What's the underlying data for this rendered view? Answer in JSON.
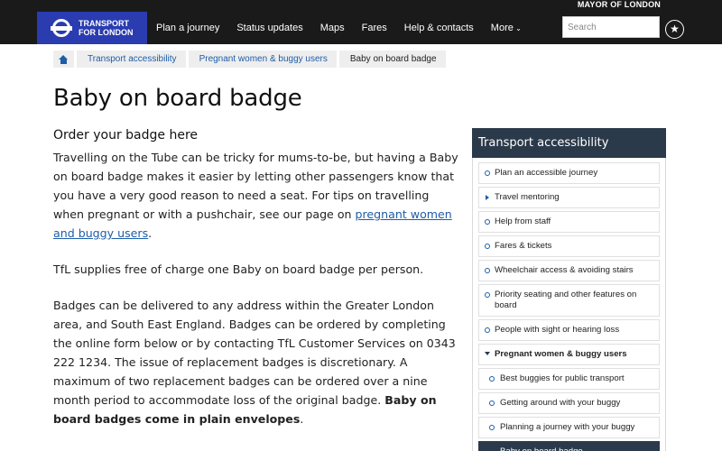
{
  "header": {
    "mayor": "MAYOR OF LONDON",
    "logo_line1": "TRANSPORT",
    "logo_line2": "FOR LONDON",
    "nav": [
      "Plan a journey",
      "Status updates",
      "Maps",
      "Fares",
      "Help & contacts",
      "More"
    ],
    "search_placeholder": "Search",
    "star_icon": "star-icon"
  },
  "breadcrumb": [
    "Transport accessibility",
    "Pregnant women & buggy users",
    "Baby on board badge"
  ],
  "main": {
    "title": "Baby on board badge",
    "subhead": "Order your badge here",
    "p1_before": "Travelling on the Tube can be tricky for mums-to-be, but having a Baby on board badge makes it easier by letting other passengers know that you have a very good reason to need a seat. For tips on travelling when pregnant or with a pushchair, see our page on ",
    "p1_link": "pregnant women and buggy users",
    "p1_after": ".",
    "p2": "TfL supplies free of charge one Baby on board badge per person.",
    "p3_text": "Badges can be delivered to any address within the Greater London area, and South East England. Badges can be ordered by completing the online form below or by contacting TfL Customer Services on 0343 222 1234. The issue of replacement badges is discretionary. A maximum of two replacement badges can be ordered over a nine month period to accommodate loss of the original badge. ",
    "p3_bold": "Baby on board badges come in plain envelopes",
    "p3_end": "."
  },
  "sidebar": {
    "heading": "Transport accessibility",
    "items": [
      "Plan an accessible journey",
      "Travel mentoring",
      "Help from staff",
      "Fares & tickets",
      "Wheelchair access & avoiding stairs",
      "Priority seating and other features on board",
      "People with sight or hearing loss",
      "Pregnant women & buggy users"
    ],
    "subitems": [
      "Best buggies for public transport",
      "Getting around with your buggy",
      "Planning a journey with your buggy",
      "Baby on board badge"
    ]
  },
  "colors": {
    "header_bg": "#1a1a1a",
    "logo_bg": "#2a3cb0",
    "sidebar_head": "#2b3a4a",
    "link": "#1d5da8"
  }
}
